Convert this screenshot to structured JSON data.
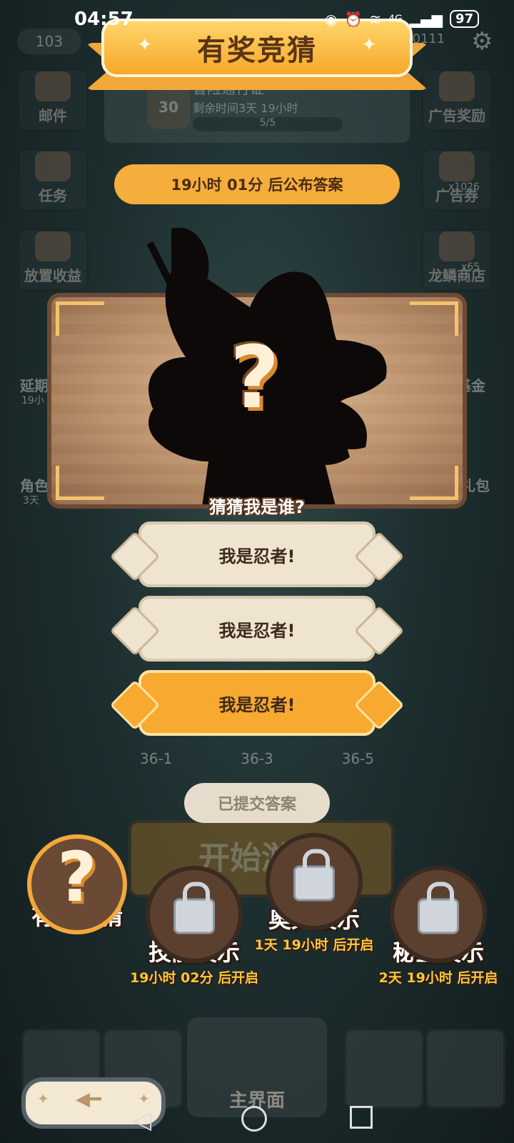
{
  "status_bar": {
    "time": "04:57",
    "signal": "4G",
    "battery": "97"
  },
  "banner": {
    "title": "有奖竞猜"
  },
  "background": {
    "level": "103",
    "pass_title": "冒险通行证",
    "pass_subtitle": "剩余时间3天 19小时",
    "pass_level": "30",
    "pass_progress": "5/5",
    "currency": "90111",
    "left_buttons": [
      "邮件",
      "任务",
      "放置收益",
      "延期",
      "19小",
      "角色",
      "3天"
    ],
    "right_buttons": [
      "广告奖励",
      "广告券",
      "x1026",
      "龙鳞商店",
      "x65",
      "基金",
      "礼包"
    ],
    "start_label": "开始游戏",
    "stages": [
      "36-1",
      "36-3",
      "36-5"
    ],
    "main_label": "主界面"
  },
  "timer": {
    "text": "19小时 01分 后公布答案"
  },
  "guess": {
    "caption": "猜猜我是谁?"
  },
  "answers": [
    {
      "label": "我是忍者!",
      "selected": false
    },
    {
      "label": "我是忍者!",
      "selected": false
    },
    {
      "label": "我是忍者!",
      "selected": true
    }
  ],
  "submitted": {
    "label": "已提交答案"
  },
  "features": [
    {
      "label": "有奖竞猜",
      "sub": ""
    },
    {
      "label": "技能展示",
      "sub": "19小时 02分 后开启"
    },
    {
      "label": "奥义展示",
      "sub": "1天 19小时 后开启"
    },
    {
      "label": "秘宝展示",
      "sub": "2天 19小时 后开启"
    }
  ],
  "colors": {
    "accent": "#f5ad3c",
    "panel": "#b88c66",
    "answer": "#efe4cf"
  }
}
